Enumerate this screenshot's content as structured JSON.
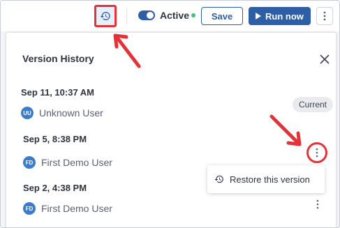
{
  "toolbar": {
    "history_icon": "history-icon",
    "toggle_state": "on",
    "active_label": "Active",
    "save_label": "Save",
    "run_label": "Run now",
    "more_icon": "kebab-icon"
  },
  "panel": {
    "title": "Version History",
    "versions": [
      {
        "date": "Sep 11, 10:37 AM",
        "initials": "UU",
        "user": "Unknown User",
        "badge": "Current"
      },
      {
        "date": "Sep 5, 8:38 PM",
        "initials": "FD",
        "user": "First Demo User"
      },
      {
        "date": "Sep 2, 4:38 PM",
        "initials": "FD",
        "user": "First Demo User"
      }
    ],
    "menu": {
      "restore_label": "Restore this version",
      "restore_icon": "history-icon"
    }
  },
  "colors": {
    "accent": "#2e5fa6",
    "highlight": "#e53238",
    "active_dot": "#3ec479",
    "avatar": "#3d7cc9"
  }
}
